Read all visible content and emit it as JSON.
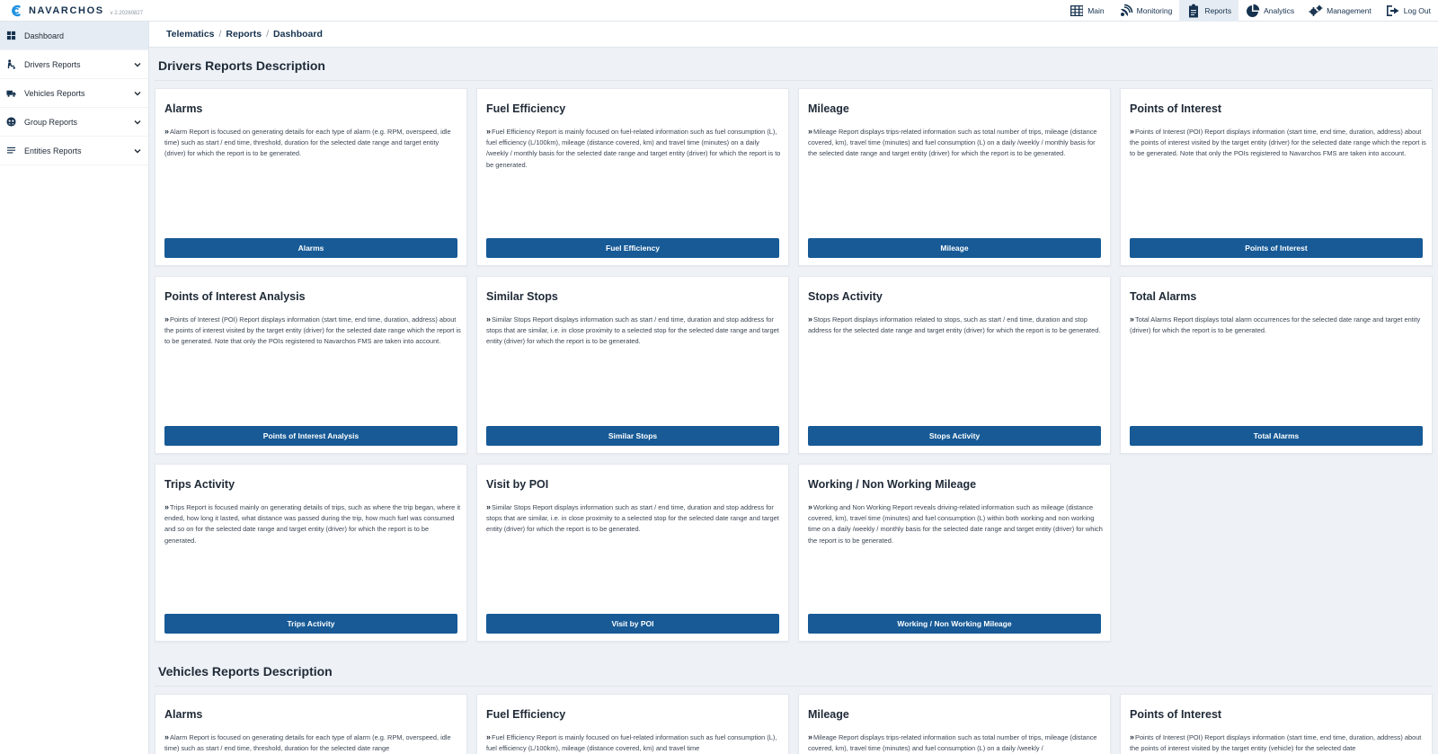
{
  "app": {
    "name": "NAVARCHOS",
    "version": "v 2.20260827"
  },
  "topnav": [
    {
      "label": "Main",
      "icon": "grid-icon"
    },
    {
      "label": "Monitoring",
      "icon": "satellite-icon"
    },
    {
      "label": "Reports",
      "icon": "clipboard-icon",
      "active": true
    },
    {
      "label": "Analytics",
      "icon": "pie-chart-icon"
    },
    {
      "label": "Management",
      "icon": "gears-icon"
    },
    {
      "label": "Log Out",
      "icon": "logout-icon"
    }
  ],
  "sidebar": {
    "items": [
      {
        "label": "Dashboard",
        "icon": "dashboard-icon",
        "active": true
      },
      {
        "label": "Drivers Reports",
        "icon": "driver-icon"
      },
      {
        "label": "Vehicles Reports",
        "icon": "truck-icon"
      },
      {
        "label": "Group Reports",
        "icon": "group-icon"
      },
      {
        "label": "Entities Reports",
        "icon": "list-icon"
      }
    ]
  },
  "breadcrumb": [
    "Telematics",
    "Reports",
    "Dashboard"
  ],
  "colors": {
    "accent": "#175a96",
    "brand": "#16324f",
    "background": "#eef2f7"
  },
  "sections": [
    {
      "title": "Drivers Reports Description",
      "cards": [
        {
          "title": "Alarms",
          "description": "Alarm Report is focused on generating details for each type of alarm (e.g. RPM, overspeed, idle time) such as start / end time, threshold, duration for the selected date range and target entity (driver) for which the report is to be generated.",
          "button": "Alarms"
        },
        {
          "title": "Fuel Efficiency",
          "description": "Fuel Efficiency Report is mainly focused on fuel-related information such as fuel consumption (L), fuel efficiency (L/100km), mileage (distance covered, km) and travel time (minutes) on a daily /weekly / monthly basis for the selected date range and target entity (driver) for which the report is to be generated.",
          "button": "Fuel Efficiency"
        },
        {
          "title": "Mileage",
          "description": "Mileage Report displays trips-related information such as total number of trips, mileage (distance covered, km), travel time (minutes) and fuel consumption (L) on a daily /weekly / monthly basis for the selected date range and target entity (driver) for which the report is to be generated.",
          "button": "Mileage"
        },
        {
          "title": "Points of Interest",
          "description": "Points of Interest (POI) Report displays information (start time, end time, duration, address) about the points of interest visited by the target entity (driver) for the selected date range which the report is to be generated. Note that only the POIs registered to Navarchos FMS are taken into account.",
          "button": "Points of Interest"
        },
        {
          "title": "Points of Interest Analysis",
          "description": "Points of Interest (POI) Report displays information (start time, end time, duration, address) about the points of interest visited by the target entity (driver) for the selected date range which the report is to be generated. Note that only the POIs registered to Navarchos FMS are taken into account.",
          "button": "Points of Interest Analysis"
        },
        {
          "title": "Similar Stops",
          "description": "Similar Stops Report displays information such as start / end time, duration and stop address for stops that are similar, i.e. in close proximity to a selected stop for the selected date range and target entity (driver) for which the report is to be generated.",
          "button": "Similar Stops"
        },
        {
          "title": "Stops Activity",
          "description": "Stops Report displays information related to stops, such as start / end time, duration and stop address for the selected date range and target entity (driver) for which the report is to be generated.",
          "button": "Stops Activity"
        },
        {
          "title": "Total Alarms",
          "description": "Total Alarms Report displays total alarm occurrences for the selected date range and target entity (driver) for which the report is to be generated.",
          "button": "Total Alarms"
        },
        {
          "title": "Trips Activity",
          "description": "Trips Report is focused mainly on generating details of trips, such as where the trip began, where it ended, how long it lasted, what distance was passed during the trip, how much fuel was consumed and so on for the selected date range and target entity (driver) for which the report is to be generated.",
          "button": "Trips Activity"
        },
        {
          "title": "Visit by POI",
          "description": "Similar Stops Report displays information such as start / end time, duration and stop address for stops that are similar, i.e. in close proximity to a selected stop for the selected date range and target entity (driver) for which the report is to be generated.",
          "button": "Visit by POI"
        },
        {
          "title": "Working / Non Working Mileage",
          "description": "Working and Non Working Report reveals driving-related information such as mileage (distance covered, km), travel time (minutes) and fuel consumption (L) within both working and non working time on a daily /weekly / monthly basis for the selected date range and target entity (driver) for which the report is to be generated.",
          "button": "Working / Non Working Mileage"
        }
      ]
    },
    {
      "title": "Vehicles Reports Description",
      "cards": [
        {
          "title": "Alarms",
          "description": "Alarm Report is focused on generating details for each type of alarm (e.g. RPM, overspeed, idle time) such as start / end time, threshold, duration for the selected date range"
        },
        {
          "title": "Fuel Efficiency",
          "description": "Fuel Efficiency Report is mainly focused on fuel-related information such as fuel consumption (L), fuel efficiency (L/100km), mileage (distance covered, km) and travel time"
        },
        {
          "title": "Mileage",
          "description": "Mileage Report displays trips-related information such as total number of trips, mileage (distance covered, km), travel time (minutes) and fuel consumption (L) on a daily /weekly /"
        },
        {
          "title": "Points of Interest",
          "description": "Points of Interest (POI) Report displays information (start time, end time, duration, address) about the points of interest visited by the target entity (vehicle) for the selected date"
        }
      ]
    }
  ]
}
